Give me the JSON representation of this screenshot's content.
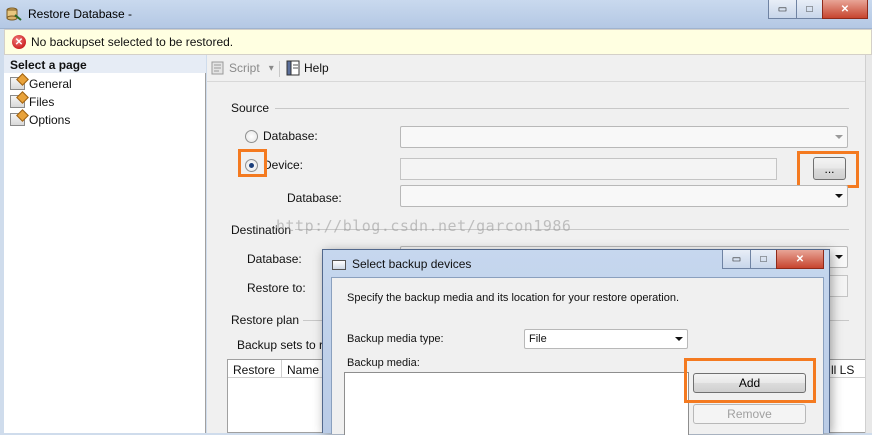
{
  "window": {
    "title": "Restore Database -",
    "icon": "restore-database-icon",
    "min_glyph": "▭",
    "max_glyph": "□",
    "close_glyph": "✕"
  },
  "error_banner": {
    "icon": "error-circle-icon",
    "icon_glyph": "✕",
    "text": "No backupset selected to be restored."
  },
  "left_pane": {
    "header": "Select a page",
    "items": [
      {
        "label": "General"
      },
      {
        "label": "Files"
      },
      {
        "label": "Options"
      }
    ]
  },
  "toolbar": {
    "script_label": "Script",
    "script_arrow": "▾",
    "help_label": "Help"
  },
  "source": {
    "section_label": "Source",
    "database_radio_label": "Database:",
    "device_radio_label": "Device:",
    "device_value": "",
    "browse_button_label": "...",
    "device_database_label": "Database:",
    "selected_option": "Device"
  },
  "destination": {
    "section_label": "Destination",
    "database_label": "Database:",
    "restore_to_label": "Restore to:"
  },
  "restore_plan": {
    "section_label": "Restore plan",
    "backup_sets_label": "Backup sets to re",
    "columns": [
      "Restore",
      "Name"
    ],
    "clipped_column": "ll LS"
  },
  "watermark": "http://blog.csdn.net/garcon1986",
  "dialog": {
    "title": "Select backup devices",
    "icon": "dialog-window-icon",
    "description": "Specify the backup media and its location for your restore operation.",
    "media_type_label": "Backup media type:",
    "media_type_value": "File",
    "media_label": "Backup media:",
    "add_button_label": "Add",
    "remove_button_label": "Remove",
    "min_glyph": "▭",
    "max_glyph": "□",
    "close_glyph": "✕"
  },
  "colors": {
    "highlight": "#f47a20",
    "banner_bg": "#ffffe1",
    "error_red": "#c00000",
    "titlebar": "#b4c8e4"
  }
}
